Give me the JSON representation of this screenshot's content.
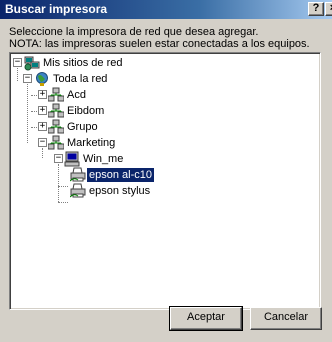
{
  "window": {
    "title": "Buscar impresora",
    "help_label": "?",
    "close_label": "×"
  },
  "instructions": {
    "line1": "Seleccione la impresora de red que desea agregar.",
    "line2": "NOTA: las impresoras suelen estar conectadas a los equipos."
  },
  "tree": {
    "items": [
      {
        "label": "Mis sitios de red",
        "expander": "−",
        "icon": "network-places-icon"
      },
      {
        "label": "Toda la red",
        "expander": "−",
        "icon": "globe-icon"
      },
      {
        "label": "Acd",
        "expander": "+",
        "icon": "workgroup-icon"
      },
      {
        "label": "Eibdom",
        "expander": "+",
        "icon": "workgroup-icon"
      },
      {
        "label": "Grupo",
        "expander": "+",
        "icon": "workgroup-icon"
      },
      {
        "label": "Marketing",
        "expander": "−",
        "icon": "workgroup-icon"
      },
      {
        "label": "Win_me",
        "expander": "−",
        "icon": "computer-icon"
      },
      {
        "label": "epson al-c10",
        "icon": "printer-icon",
        "selected": true
      },
      {
        "label": "epson stylus",
        "icon": "printer-icon"
      }
    ]
  },
  "buttons": {
    "ok_label": "Aceptar",
    "cancel_label": "Cancelar"
  },
  "colors": {
    "titlebar_start": "#0a246a",
    "titlebar_end": "#a6caf0",
    "selection": "#0a246a",
    "face": "#d4d0c8"
  }
}
